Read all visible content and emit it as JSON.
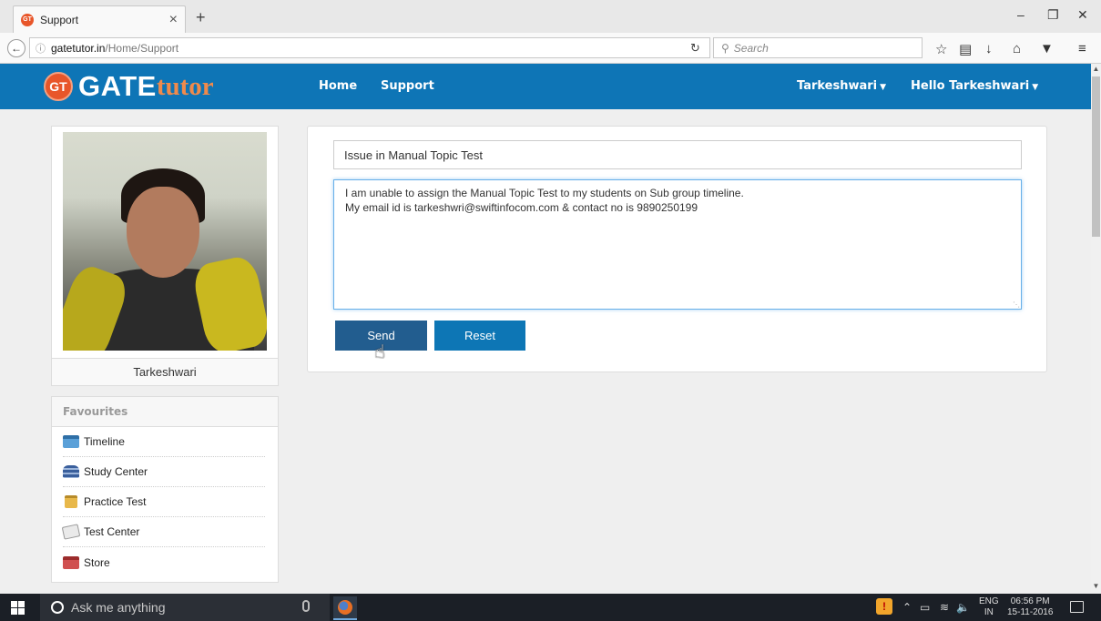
{
  "browser": {
    "tab_title": "Support",
    "tab_close": "×",
    "new_tab": "+",
    "url_host": "gatetutor.in",
    "url_path": "/Home/Support",
    "search_placeholder": "Search",
    "icons": [
      "back-arrow-icon",
      "info-icon",
      "reload-icon",
      "search-icon",
      "bookmark-star-icon",
      "reading-list-icon",
      "download-icon",
      "home-icon",
      "pocket-icon",
      "menu-icon"
    ]
  },
  "window": {
    "minimize": "–",
    "restore": "❐",
    "close": "✕"
  },
  "site": {
    "logo_badge": "GT",
    "logo_gate": "GATE",
    "logo_tutor": "tutor",
    "nav_home": "Home",
    "nav_support": "Support",
    "user_menu": "Tarkeshwari",
    "greeting_menu": "Hello Tarkeshwari",
    "brand_color": "#0e75b6",
    "accent_color": "#e8562a"
  },
  "profile": {
    "name": "Tarkeshwari"
  },
  "favourites": {
    "heading": "Favourites",
    "items": [
      {
        "label": "Timeline",
        "icon": "timeline-icon"
      },
      {
        "label": "Study Center",
        "icon": "books-icon"
      },
      {
        "label": "Practice Test",
        "icon": "clipboard-icon"
      },
      {
        "label": "Test Center",
        "icon": "test-paper-icon"
      },
      {
        "label": "Store",
        "icon": "store-icon"
      }
    ]
  },
  "support_form": {
    "subject": "Issue in Manual Topic Test",
    "message": "I am unable to assign the Manual Topic Test to my students on Sub group timeline.\nMy email id is tarkeshwri@swiftinfocom.com & contact no is 9890250199",
    "send_label": "Send",
    "reset_label": "Reset"
  },
  "taskbar": {
    "search_text": "Ask me anything",
    "lang_top": "ENG",
    "lang_bottom": "IN",
    "time": "06:56 PM",
    "date": "15-11-2016"
  }
}
